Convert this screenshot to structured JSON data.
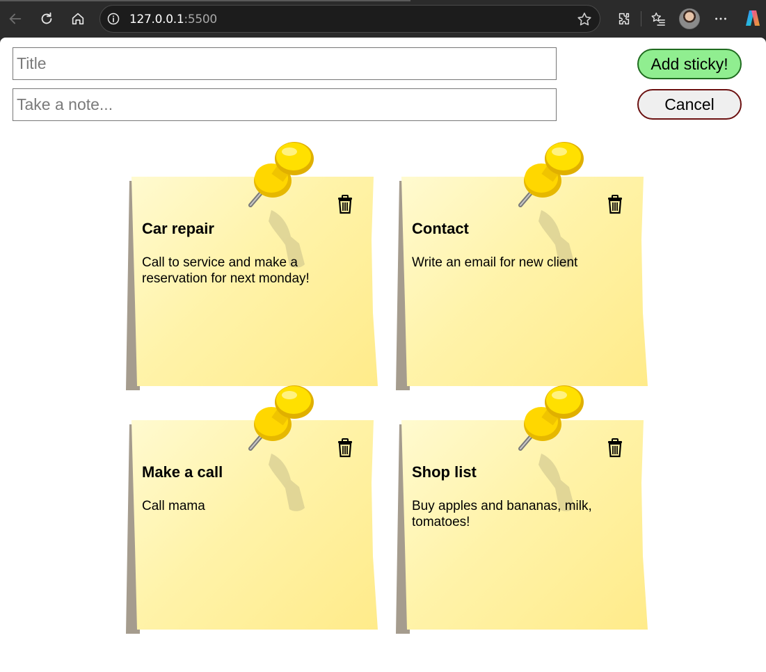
{
  "browser": {
    "url_host": "127.0.0.1",
    "url_port": ":5500"
  },
  "form": {
    "title_placeholder": "Title",
    "note_placeholder": "Take a note...",
    "add_label": "Add sticky!",
    "cancel_label": "Cancel"
  },
  "notes": [
    {
      "title": "Car repair",
      "body": "Call to service and make a reservation for next monday!"
    },
    {
      "title": "Contact",
      "body": "Write an email for new client"
    },
    {
      "title": "Make a call",
      "body": "Call mama"
    },
    {
      "title": "Shop list",
      "body": "Buy apples and bananas, milk, tomatoes!"
    }
  ],
  "colors": {
    "add_button": "#90ee90",
    "note_paper": "#fff3a9",
    "pin": "#ffd700"
  },
  "icons": {
    "note_delete": "trash-icon",
    "note_pin": "pushpin-icon"
  }
}
